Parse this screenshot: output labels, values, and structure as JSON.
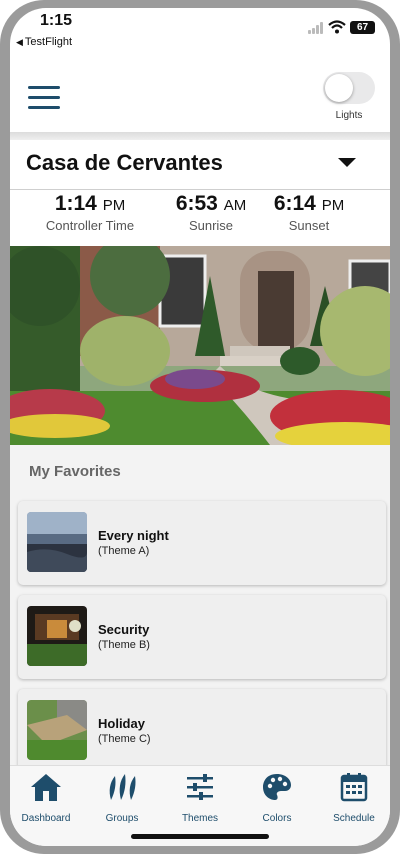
{
  "status_bar": {
    "time": "1:15",
    "back_app": "TestFlight",
    "battery": "67"
  },
  "header": {
    "lights_label": "Lights",
    "lights_on": false
  },
  "location": {
    "name": "Casa de Cervantes"
  },
  "times": [
    {
      "time": "1:14",
      "ampm": "PM",
      "label": "Controller Time"
    },
    {
      "time": "6:53",
      "ampm": "AM",
      "label": "Sunrise"
    },
    {
      "time": "6:14",
      "ampm": "PM",
      "label": "Sunset"
    }
  ],
  "favorites": {
    "title": "My Favorites",
    "items": [
      {
        "name": "Every night",
        "theme": "(Theme A)"
      },
      {
        "name": "Security",
        "theme": "(Theme B)"
      },
      {
        "name": "Holiday",
        "theme": "(Theme C)"
      }
    ]
  },
  "tabs": [
    {
      "label": "Dashboard",
      "icon": "home-icon"
    },
    {
      "label": "Groups",
      "icon": "groups-icon"
    },
    {
      "label": "Themes",
      "icon": "sliders-icon"
    },
    {
      "label": "Colors",
      "icon": "palette-icon"
    },
    {
      "label": "Schedule",
      "icon": "calendar-icon"
    }
  ],
  "colors": {
    "accent": "#1e4d6b"
  }
}
